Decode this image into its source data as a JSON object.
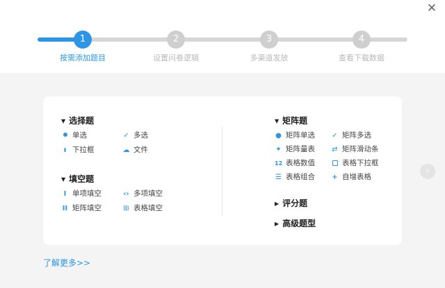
{
  "dialog": {
    "close_glyph": "✕"
  },
  "steps": [
    {
      "number": "1",
      "label": "按需添加题目",
      "state": "active"
    },
    {
      "number": "2",
      "label": "设置问卷逻辑",
      "state": "inactive"
    },
    {
      "number": "3",
      "label": "多渠道发放",
      "state": "inactive"
    },
    {
      "number": "4",
      "label": "查看下载数据",
      "state": "inactive"
    }
  ],
  "groups": {
    "choice": {
      "title": "选择题",
      "items": [
        {
          "label": "单选",
          "icon": "radio-dot-icon"
        },
        {
          "label": "多选",
          "icon": "checkmark-icon"
        },
        {
          "label": "下拉框",
          "icon": "dropdown-arrows-icon"
        },
        {
          "label": "文件",
          "icon": "cloud-upload-icon"
        }
      ]
    },
    "fill": {
      "title": "填空题",
      "items": [
        {
          "label": "单项填空",
          "icon": "text-cursor-icon"
        },
        {
          "label": "多项填空",
          "icon": "brackets-icon"
        },
        {
          "label": "矩阵填空",
          "icon": "double-cursor-icon"
        },
        {
          "label": "表格填空",
          "icon": "table-icon"
        }
      ]
    },
    "matrix": {
      "title": "矩阵题",
      "items": [
        {
          "label": "矩阵单选",
          "icon": "matrix-radio-icon"
        },
        {
          "label": "矩阵多选",
          "icon": "matrix-check-icon"
        },
        {
          "label": "矩阵量表",
          "icon": "matrix-scale-icon"
        },
        {
          "label": "矩阵滑动条",
          "icon": "slider-icon"
        },
        {
          "label": "表格数值",
          "icon": "number-12-icon",
          "glyph": "12"
        },
        {
          "label": "表格下拉框",
          "icon": "dropdown-box-icon"
        },
        {
          "label": "表格组合",
          "icon": "grid-combo-icon"
        },
        {
          "label": "自增表格",
          "icon": "plus-icon"
        }
      ]
    },
    "score": {
      "title": "评分题"
    },
    "advanced": {
      "title": "高级题型"
    }
  },
  "navigation": {
    "next_glyph": "›"
  },
  "footer": {
    "learn_more": "了解更多>>"
  },
  "colors": {
    "accent": "#2c95e6",
    "inactive_step": "#cfcfcf",
    "background": "#f4f4f5"
  }
}
